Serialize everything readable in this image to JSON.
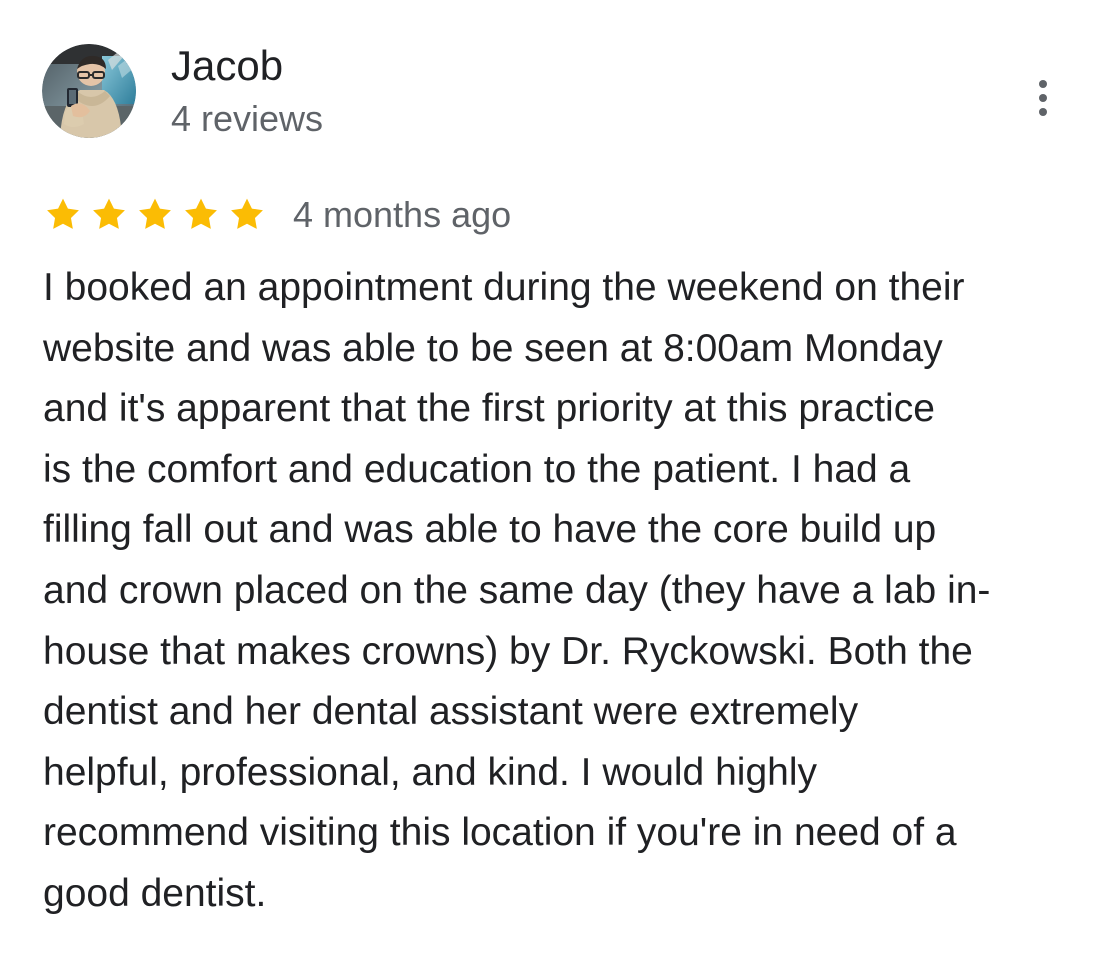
{
  "review": {
    "reviewer": {
      "name": "Jacob",
      "review_count": "4 reviews",
      "avatar_icon": "reviewer-photo"
    },
    "more_options_icon": "more-vertical-icon",
    "rating": {
      "value": 5,
      "max": 5,
      "star_color": "#fbbc04",
      "empty_star_color": "#dadce0"
    },
    "date": "4 months ago",
    "text_lines": [
      "I booked an appointment during the weekend on their",
      "website and was able to be seen at 8:00am Monday",
      "and it's apparent that the first priority at this practice",
      "is the comfort and education to the patient. I had a",
      "filling fall out and was able to have the core build up",
      "and crown placed on the same day (they have a lab in-",
      "house that makes crowns) by Dr. Ryckowski. Both the",
      "dentist and her dental assistant were extremely",
      "helpful, professional, and kind. I would highly",
      "recommend visiting this location if you're in need of a",
      "good dentist."
    ]
  }
}
